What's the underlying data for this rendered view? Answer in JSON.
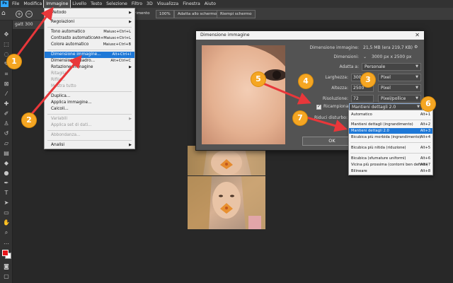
{
  "menubar": {
    "items": [
      {
        "label": "File"
      },
      {
        "label": "Modifica"
      },
      {
        "label": "Immagine",
        "active": true
      },
      {
        "label": "Livello"
      },
      {
        "label": "Testo"
      },
      {
        "label": "Selezione"
      },
      {
        "label": "Filtro"
      },
      {
        "label": "3D"
      },
      {
        "label": "Visualizza"
      },
      {
        "label": "Finestra"
      },
      {
        "label": "Aiuto"
      }
    ]
  },
  "optionsbar": {
    "fit_label": "rimento",
    "zoom_100": "100%",
    "fit_screen": "Adatta allo schermo",
    "fill_screen": "Riempi schermo"
  },
  "document_tab": {
    "title": "gatt 300"
  },
  "image_menu": {
    "items": [
      {
        "label": "Metodo",
        "submenu": true
      },
      {
        "label": "Regolazioni",
        "submenu": true
      },
      {
        "label": "Tono automatico",
        "shortcut": "Maiusc+Ctrl+L"
      },
      {
        "label": "Contrasto automatico",
        "shortcut": "Alt+Maiusc+Ctrl+L"
      },
      {
        "label": "Colore automatico",
        "shortcut": "Maiusc+Ctrl+B"
      },
      {
        "label": "Dimensione immagine...",
        "shortcut": "Alt+Ctrl+I",
        "selected": true
      },
      {
        "label": "Dimensione quadro...",
        "shortcut": "Alt+Ctrl+C"
      },
      {
        "label": "Rotazione immagine",
        "submenu": true
      },
      {
        "label": "Ritaglia",
        "disabled": true
      },
      {
        "label": "Rifila...",
        "disabled": true
      },
      {
        "label": "Mostra tutto",
        "disabled": true
      },
      {
        "label": "Duplica..."
      },
      {
        "label": "Applica immagine..."
      },
      {
        "label": "Calcoli..."
      },
      {
        "label": "Variabili",
        "disabled": true,
        "submenu": true
      },
      {
        "label": "Applica set di dati...",
        "disabled": true
      },
      {
        "label": "Abbondanza...",
        "disabled": true
      },
      {
        "label": "Analisi",
        "submenu": true
      }
    ]
  },
  "dialog": {
    "title": "Dimensione immagine",
    "close": "✕",
    "size_label": "Dimensione immagine:",
    "size_value": "21,5 MB (era 219,7 KB)",
    "dims_label": "Dimensioni:",
    "dims_value": "3000 px x 2500 px",
    "fit_label": "Adatta a:",
    "fit_value": "Personale",
    "width_label": "Larghezza:",
    "width_value": "3000",
    "width_unit": "Pixel",
    "height_label": "Altezza:",
    "height_value": "2500",
    "height_unit": "Pixel",
    "res_label": "Risoluzione:",
    "res_value": "72",
    "res_unit": "Pixel/pollice",
    "resample_label": "Ricampiona:",
    "resample_value": "Mantieni dettagli 2.0",
    "noise_label": "Riduci disturbo:",
    "ok_label": "OK"
  },
  "resample_options": [
    {
      "label": "Automatico",
      "shortcut": "Alt+1"
    },
    {
      "label": "Mantieni dettagli (ingrandimento)",
      "shortcut": "Alt+2"
    },
    {
      "label": "Mantieni dettagli 2.0",
      "shortcut": "Alt+3",
      "selected": true
    },
    {
      "label": "Bicubica più morbida (ingrandimento)",
      "shortcut": "Alt+4"
    },
    {
      "label": "Bicubica più nitida (riduzione)",
      "shortcut": "Alt+5"
    },
    {
      "label": "Bicubica (sfumature uniformi)",
      "shortcut": "Alt+6"
    },
    {
      "label": "Vicina più prossima (contorni ben definiti)",
      "shortcut": "Alt+7"
    },
    {
      "label": "Bilineare",
      "shortcut": "Alt+8"
    }
  ],
  "callouts": [
    "1",
    "2",
    "3",
    "4",
    "5",
    "6",
    "7"
  ],
  "colors": {
    "accent_selection": "#1e78d7",
    "callout": "#f5a623",
    "arrow": "#e8373a",
    "foreground_swatch": "#e8161b"
  },
  "icons": [
    "home-icon",
    "zoom-in-icon",
    "zoom-out-icon",
    "chain-link-icon",
    "gear-icon",
    "close-icon"
  ]
}
